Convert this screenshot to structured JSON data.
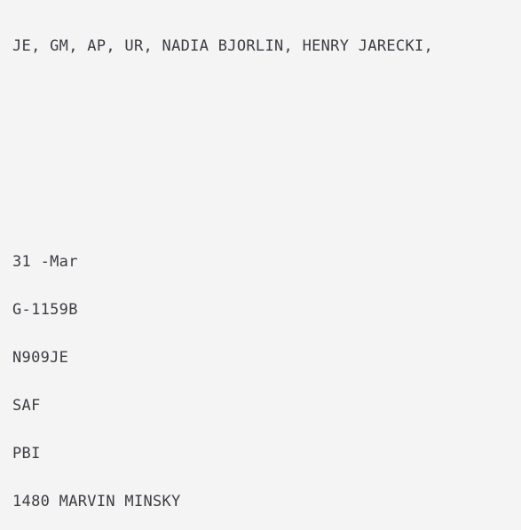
{
  "document": {
    "type": "flight-log-record",
    "background_color": "#f4f4f5",
    "text_color": "#3c3c44",
    "lines": {
      "passengers": "JE, GM, AP, UR, NADIA BJORLIN, HENRY JARECKI,",
      "date": "31 -Mar",
      "aircraft_model": "G-1159B",
      "tail_number": "N909JE",
      "origin": "SAF",
      "destination": "PBI",
      "document_id": "1480 MARVIN MINSKY"
    }
  }
}
